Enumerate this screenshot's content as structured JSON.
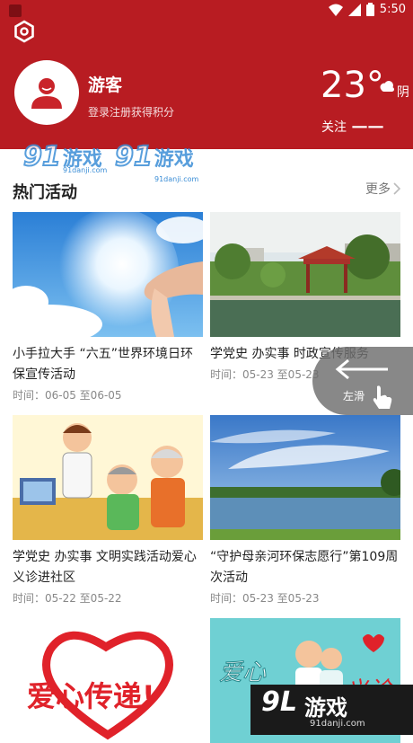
{
  "status_bar": {
    "time": "5:50"
  },
  "profile": {
    "name": "游客",
    "login_hint": "登录注册获得积分"
  },
  "weather": {
    "temperature": "23°",
    "condition": "阴"
  },
  "follow": {
    "label": "关注",
    "value": "一一"
  },
  "section": {
    "title": "热门活动",
    "more_label": "更多"
  },
  "cards": [
    {
      "title": "小手拉大手 “六五”世界环境日环保宣传活动",
      "time": "时间：06-05 至06-05"
    },
    {
      "title": "学党史 办实事 时政宣传服务",
      "time": "时间：05-23 至05-23"
    },
    {
      "title": "学党史 办实事 文明实践活动爱心义诊进社区",
      "time": "时间：05-22 至05-22"
    },
    {
      "title": "“守护母亲河环保志愿行”第109周次活动",
      "time": "时间：05-23 至05-23"
    },
    {
      "image_text": "爱心传递!"
    },
    {
      "image_text_left": "爱心",
      "image_text_right": "义诊"
    }
  ],
  "swipe_hint": {
    "label": "左滑"
  },
  "watermarks": {
    "top_num": "91",
    "top_text": "游戏",
    "top_sub": "91danji.com",
    "br_num": "9L",
    "br_text": "游戏",
    "br_sub": "91danji.com"
  },
  "colors": {
    "brand_red": "#b81c22",
    "watermark_blue": "#3b8ed6"
  }
}
